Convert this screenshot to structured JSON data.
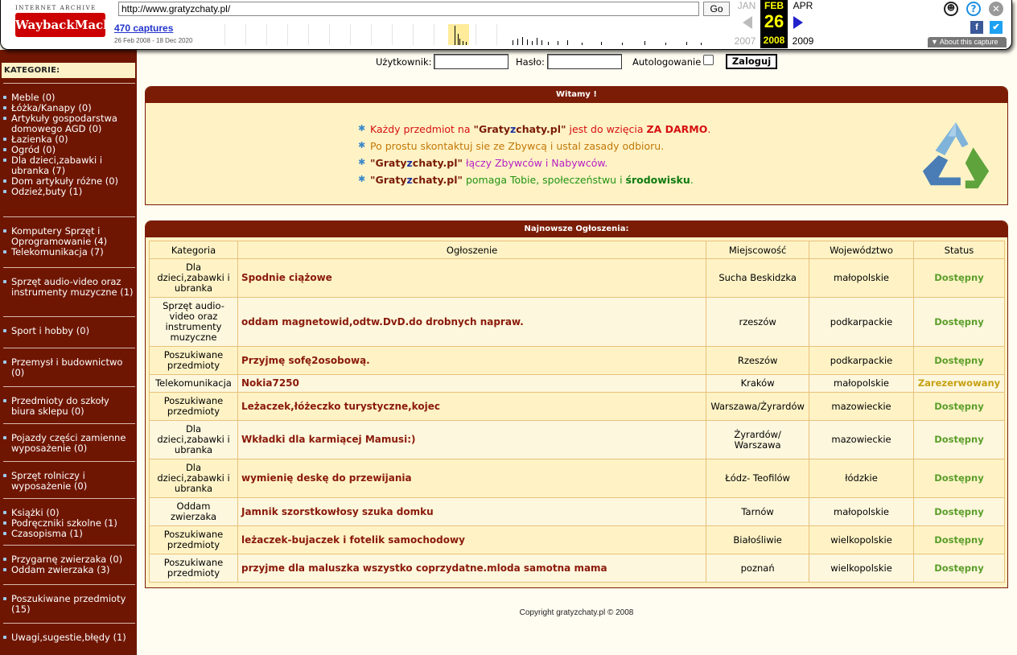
{
  "wayback": {
    "logo_top": "INTERNET ARCHIVE",
    "logo_main": "WaybackMachine",
    "url": "http://www.gratyzchaty.pl/",
    "go_label": "Go",
    "captures": "470 captures",
    "range": "26 Feb 2008 - 18 Dec 2020",
    "prev_month": "JAN",
    "cur_month": "FEB",
    "next_month": "APR",
    "cur_day": "26",
    "prev_year": "2007",
    "cur_year": "2008",
    "next_year": "2009",
    "about": "About this capture",
    "icons": {
      "user": "user-icon",
      "help": "help-icon",
      "close": "close-icon",
      "facebook": "facebook-icon",
      "twitter": "twitter-icon"
    }
  },
  "sidebar": {
    "heading": "KATEGORIE:",
    "groups": [
      [
        "Meble (0)",
        "Łóżka/Kanapy (0)",
        "Artykuły gospodarstwa domowego AGD (0)",
        "Łazienka (0)",
        "Ogród (0)",
        "Dla dzieci,zabawki i ubranka (7)",
        "Dom artykuły różne (0)",
        "Odzież,buty (1)"
      ],
      [
        "Komputery Sprzęt i Oprogramowanie (4)",
        "Telekomunikacja (7)"
      ],
      [
        "Sprzęt audio-video oraz instrumenty muzyczne (1)"
      ],
      [
        "Sport i hobby (0)"
      ],
      [
        "Przemysł i budownictwo (0)"
      ],
      [
        "Przedmioty do szkoły biura sklepu (0)"
      ],
      [
        "Pojazdy części zamienne wyposażenie (0)"
      ],
      [
        "Sprzęt rolniczy i wyposażenie (0)"
      ],
      [
        "Książki (0)",
        "Podręczniki szkolne (1)",
        "Czasopisma (1)"
      ],
      [
        "Przygarnę zwierzaka (0)",
        "Oddam zwierzaka (3)"
      ],
      [
        "Poszukiwane przedmioty (15)"
      ],
      [
        "Uwagi,sugestie,błędy (1)"
      ]
    ]
  },
  "login": {
    "user_label": "Użytkownik:",
    "pass_label": "Hasło:",
    "auto_label": "Autologowanie",
    "button": "Zaloguj"
  },
  "welcome": {
    "title": "Witamy !",
    "l1_a": "Każdy przedmiot na ",
    "l1_b": "\"Graty",
    "l1_c": "z",
    "l1_d": "chaty.pl\"",
    "l1_e": " jest do wzięcia ",
    "l1_f": "ZA DARMO",
    "l1_g": ".",
    "l2": "Po prostu skontaktuj sie ze Zbywcą i ustal zasady odbioru.",
    "l3_b": "\"Graty",
    "l3_c": "z",
    "l3_d": "chaty.pl\"",
    "l3_e": " łączy Zbywców i Nabywców.",
    "l4_b": "\"Graty",
    "l4_c": "z",
    "l4_d": "chaty.pl\"",
    "l4_e": " pomaga Tobie, społeczeństwu i ",
    "l4_f": "środowisku",
    "l4_g": "."
  },
  "latest": {
    "title": "Najnowsze Ogłoszenia:",
    "headers": [
      "Kategoria",
      "Ogłoszenie",
      "Miejscowość",
      "Województwo",
      "Status"
    ],
    "rows": [
      [
        "Dla dzieci,zabawki i ubranka",
        "Spodnie ciążowe",
        "Sucha Beskidzka",
        "małopolskie",
        "Dostępny"
      ],
      [
        "Sprzęt audio-video oraz instrumenty muzyczne",
        "oddam magnetowid,odtw.DvD.do drobnych napraw.",
        "rzeszów",
        "podkarpackie",
        "Dostępny"
      ],
      [
        "Poszukiwane przedmioty",
        "Przyjmę sofę2osobową.",
        "Rzeszów",
        "podkarpackie",
        "Dostępny"
      ],
      [
        "Telekomunikacja",
        "Nokia7250",
        "Kraków",
        "małopolskie",
        "Zarezerwowany"
      ],
      [
        "Poszukiwane przedmioty",
        "Leżaczek,łóżeczko turystyczne,kojec",
        "Warszawa/Żyrardów",
        "mazowieckie",
        "Dostępny"
      ],
      [
        "Dla dzieci,zabawki i ubranka",
        "Wkładki dla karmiącej Mamusi:)",
        "Żyrardów/ Warszawa",
        "mazowieckie",
        "Dostępny"
      ],
      [
        "Dla dzieci,zabawki i ubranka",
        "wymienię deskę do przewijania",
        "Łódz- Teofilów",
        "łódzkie",
        "Dostępny"
      ],
      [
        "Oddam zwierzaka",
        "Jamnik szorstkowłosy szuka domku",
        "Tarnów",
        "małopolskie",
        "Dostępny"
      ],
      [
        "Poszukiwane przedmioty",
        "leżaczek-bujaczek i fotelik samochodowy",
        "Białośliwie",
        "wielkopolskie",
        "Dostępny"
      ],
      [
        "Poszukiwane przedmioty",
        "przyjme dla maluszka wszystko coprzydatne.mloda samotna mama",
        "poznań",
        "wielkopolskie",
        "Dostępny"
      ]
    ]
  },
  "copyright": "Copyright gratyzchaty.pl © 2008"
}
